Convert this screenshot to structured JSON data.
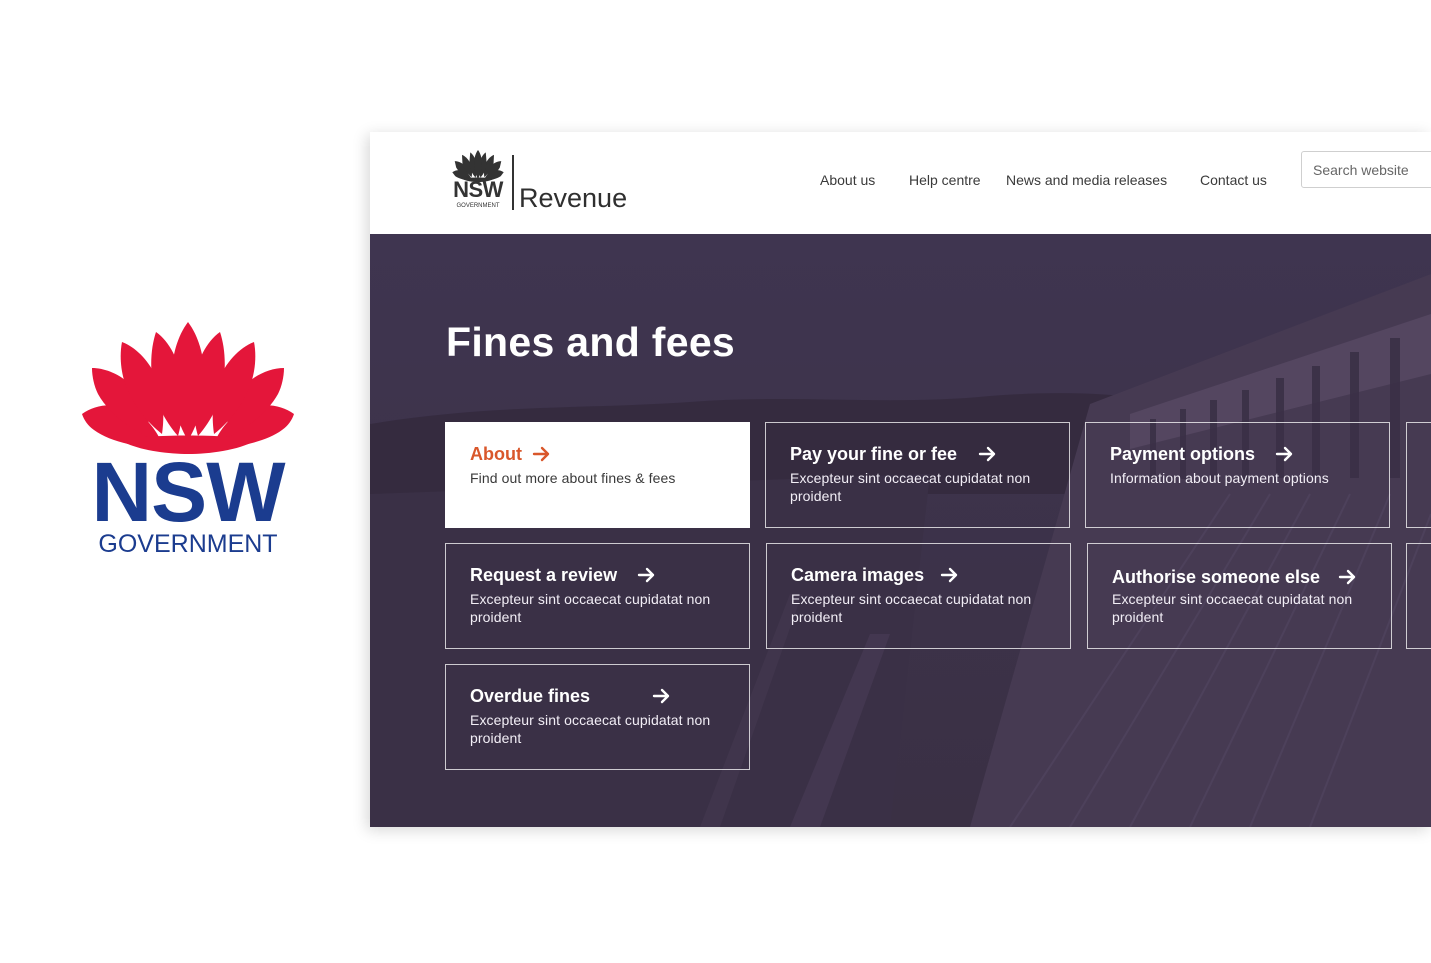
{
  "branding": {
    "big_logo_nsw": "NSW",
    "big_logo_government": "GOVERNMENT",
    "small_logo_nsw": "NSW",
    "small_logo_government": "GOVERNMENT",
    "site_name": "Revenue",
    "colors": {
      "waratah_red": "#e4163a",
      "nsw_blue": "#1b3c8f",
      "hero_overlay": "#3c3247",
      "accent_orange": "#d9572b"
    }
  },
  "nav": {
    "items": [
      {
        "label": "About us"
      },
      {
        "label": "Help centre"
      },
      {
        "label": "News and media releases"
      },
      {
        "label": "Contact us"
      }
    ]
  },
  "search": {
    "placeholder": "Search website"
  },
  "hero": {
    "title": "Fines and fees"
  },
  "cards": [
    {
      "title": "About",
      "description": "Find out more about fines & fees",
      "active": true,
      "icon": "arrow-right-icon"
    },
    {
      "title": "Pay your fine or fee",
      "description": "Excepteur sint occaecat cupidatat non proident",
      "active": false,
      "icon": "arrow-right-icon"
    },
    {
      "title": "Payment options",
      "description": "Information about payment options",
      "active": false,
      "icon": "arrow-right-icon"
    },
    {
      "title": "Request a review",
      "description": "Excepteur sint occaecat cupidatat non proident",
      "active": false,
      "icon": "arrow-right-icon"
    },
    {
      "title": "Camera images",
      "description": "Excepteur sint occaecat cupidatat non proident",
      "active": false,
      "icon": "arrow-right-icon"
    },
    {
      "title": "Authorise someone else",
      "description": "Excepteur sint occaecat cupidatat non proident",
      "active": false,
      "icon": "arrow-right-icon"
    },
    {
      "title": "Overdue fines",
      "description": "Excepteur sint occaecat cupidatat non proident",
      "active": false,
      "icon": "arrow-right-icon"
    }
  ]
}
